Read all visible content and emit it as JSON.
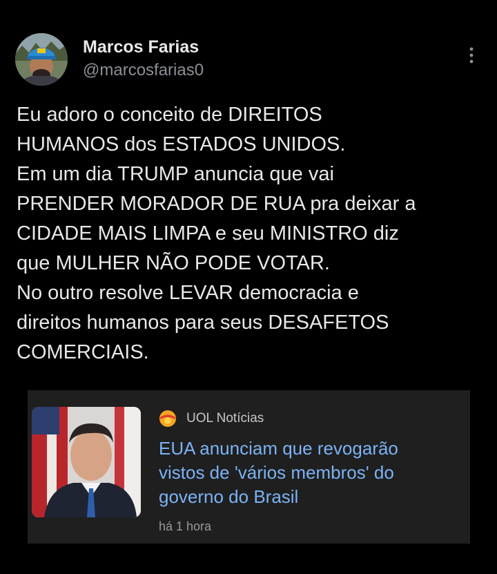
{
  "tweet": {
    "author": {
      "name": "Marcos Farias",
      "handle": "@marcosfarias0"
    },
    "text_lines": [
      "Eu adoro o conceito de DIREITOS",
      "HUMANOS dos ESTADOS UNIDOS.",
      "Em um dia TRUMP anuncia que vai",
      "PRENDER MORADOR DE RUA pra deixar a",
      "CIDADE MAIS LIMPA e seu MINISTRO diz",
      "que MULHER NÃO PODE VOTAR.",
      "No outro resolve LEVAR democracia e",
      "direitos humanos para seus DESAFETOS",
      "COMERCIAIS."
    ],
    "more_icon": "more-vertical-icon"
  },
  "news_card": {
    "source": "UOL Notícias",
    "headline_lines": [
      "EUA anunciam que revogarão",
      "vistos de 'vários membros' do",
      "governo do Brasil"
    ],
    "time": "há 1 hora",
    "logo_icon": "uol-logo-icon"
  },
  "colors": {
    "background": "#000000",
    "text": "#e7e9ea",
    "handle": "#8b9097",
    "card_background": "#1f1f1f",
    "headline": "#7bb3f5"
  }
}
